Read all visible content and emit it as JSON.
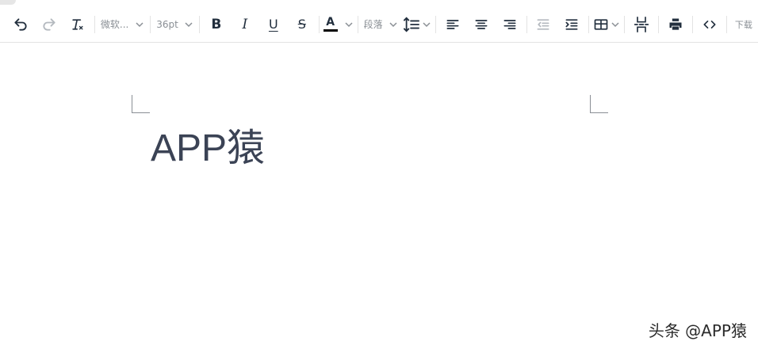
{
  "toolbar": {
    "undo": "undo",
    "redo": "redo",
    "clear_format": "clear-format",
    "font_family": "微软...",
    "font_size": "36pt",
    "bold": "B",
    "italic": "I",
    "underline": "U",
    "strikethrough": "S",
    "font_color_letter": "A",
    "font_color": "#000000",
    "block_format": "段落",
    "download": "下载"
  },
  "document": {
    "text": "APP猿"
  },
  "watermark": {
    "text": "头条 @APP猿"
  },
  "colors": {
    "toolbar_icon": "#222f3e",
    "disabled_icon": "#b4b9bf",
    "document_text": "#3b4355"
  }
}
